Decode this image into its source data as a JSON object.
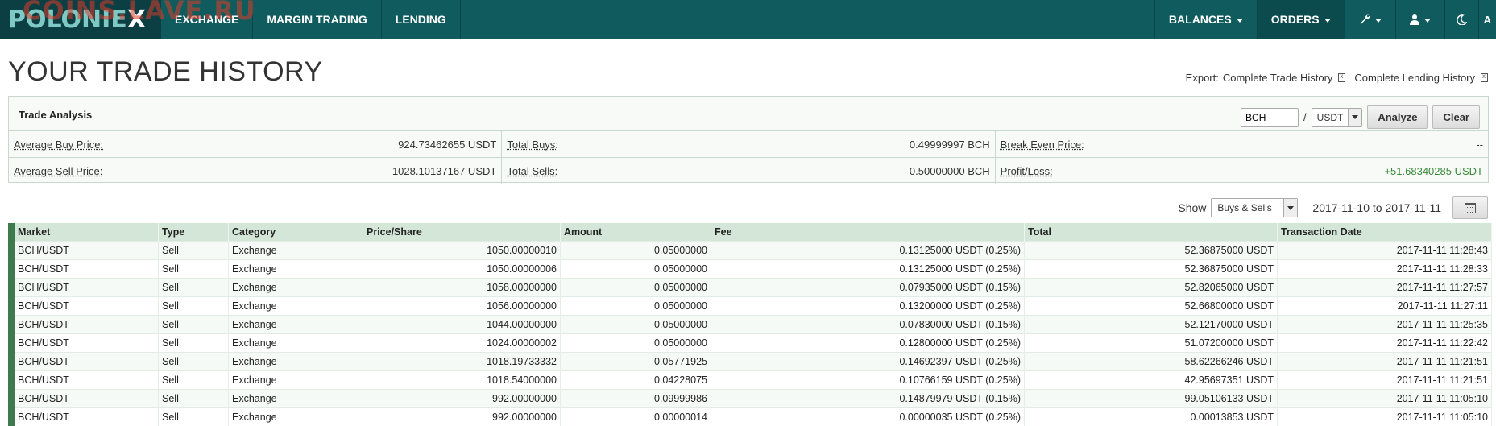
{
  "nav": {
    "logo": "POLONIEX",
    "watermark": "COINS.LAVE.RU",
    "items": [
      "EXCHANGE",
      "MARGIN TRADING",
      "LENDING"
    ],
    "right_items": [
      "BALANCES",
      "ORDERS"
    ],
    "icons": [
      "wrench-icon",
      "user-icon",
      "moon-icon"
    ]
  },
  "page": {
    "title": "YOUR TRADE HISTORY",
    "export_label": "Export:",
    "export_trade": "Complete Trade History",
    "export_lending": "Complete Lending History"
  },
  "analysis": {
    "title": "Trade Analysis",
    "base_value": "BCH",
    "slash": "/",
    "quote_value": "USDT",
    "analyze_label": "Analyze",
    "clear_label": "Clear",
    "avg_buy_label": "Average Buy Price:",
    "avg_buy_value": "924.73462655 USDT",
    "total_buys_label": "Total Buys:",
    "total_buys_value": "0.49999997 BCH",
    "break_even_label": "Break Even Price:",
    "break_even_value": "--",
    "avg_sell_label": "Average Sell Price:",
    "avg_sell_value": "1028.10137167 USDT",
    "total_sells_label": "Total Sells:",
    "total_sells_value": "0.50000000 BCH",
    "pl_label": "Profit/Loss:",
    "pl_value": "+51.68340285 USDT"
  },
  "filter": {
    "show_label": "Show",
    "show_value": "Buys & Sells",
    "date_range": "2017-11-10 to 2017-11-11"
  },
  "table": {
    "headers": [
      "Market",
      "Type",
      "Category",
      "Price/Share",
      "Amount",
      "Fee",
      "Total",
      "Transaction Date"
    ],
    "rows": [
      [
        "BCH/USDT",
        "Sell",
        "Exchange",
        "1050.00000010",
        "0.05000000",
        "0.13125000 USDT (0.25%)",
        "52.36875000 USDT",
        "2017-11-11 11:28:43"
      ],
      [
        "BCH/USDT",
        "Sell",
        "Exchange",
        "1050.00000006",
        "0.05000000",
        "0.13125000 USDT (0.25%)",
        "52.36875000 USDT",
        "2017-11-11 11:28:33"
      ],
      [
        "BCH/USDT",
        "Sell",
        "Exchange",
        "1058.00000000",
        "0.05000000",
        "0.07935000 USDT (0.15%)",
        "52.82065000 USDT",
        "2017-11-11 11:27:57"
      ],
      [
        "BCH/USDT",
        "Sell",
        "Exchange",
        "1056.00000000",
        "0.05000000",
        "0.13200000 USDT (0.25%)",
        "52.66800000 USDT",
        "2017-11-11 11:27:11"
      ],
      [
        "BCH/USDT",
        "Sell",
        "Exchange",
        "1044.00000000",
        "0.05000000",
        "0.07830000 USDT (0.15%)",
        "52.12170000 USDT",
        "2017-11-11 11:25:35"
      ],
      [
        "BCH/USDT",
        "Sell",
        "Exchange",
        "1024.00000002",
        "0.05000000",
        "0.12800000 USDT (0.25%)",
        "51.07200000 USDT",
        "2017-11-11 11:22:42"
      ],
      [
        "BCH/USDT",
        "Sell",
        "Exchange",
        "1018.19733332",
        "0.05771925",
        "0.14692397 USDT (0.25%)",
        "58.62266246 USDT",
        "2017-11-11 11:21:51"
      ],
      [
        "BCH/USDT",
        "Sell",
        "Exchange",
        "1018.54000000",
        "0.04228075",
        "0.10766159 USDT (0.25%)",
        "42.95697351 USDT",
        "2017-11-11 11:21:51"
      ],
      [
        "BCH/USDT",
        "Sell",
        "Exchange",
        "992.00000000",
        "0.09999986",
        "0.14879979 USDT (0.15%)",
        "99.05106133 USDT",
        "2017-11-11 11:05:10"
      ],
      [
        "BCH/USDT",
        "Sell",
        "Exchange",
        "992.00000000",
        "0.00000014",
        "0.00000035 USDT (0.25%)",
        "0.00013853 USDT",
        "2017-11-11 11:05:10"
      ]
    ]
  },
  "colors": {
    "nav_bg": "#0f5b5e",
    "sell": "#c0392b",
    "profit": "#3a8a3a",
    "table_header": "#d3e6d7"
  }
}
